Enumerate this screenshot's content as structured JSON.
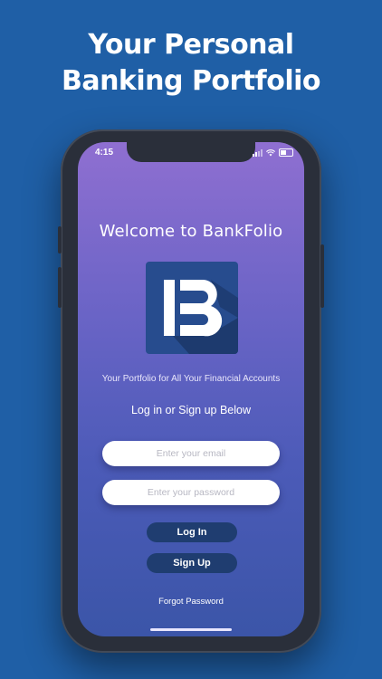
{
  "headline": {
    "line1": "Your Personal",
    "line2": "Banking Portfolio"
  },
  "status_bar": {
    "time": "4:15"
  },
  "app": {
    "welcome": "Welcome to BankFolio",
    "logo_letter": "B",
    "tagline": "Your Portfolio for All Your Financial Accounts",
    "cta": "Log in or Sign up Below",
    "email_placeholder": "Enter your email",
    "password_placeholder": "Enter your password",
    "login_label": "Log In",
    "signup_label": "Sign Up",
    "forgot_label": "Forgot Password"
  },
  "colors": {
    "page_background": "#1f5fa6",
    "gradient_top": "#8f6fd1",
    "gradient_bottom": "#3b55a8",
    "button_fill": "#1f3d70",
    "logo_bg": "#274c8e"
  }
}
